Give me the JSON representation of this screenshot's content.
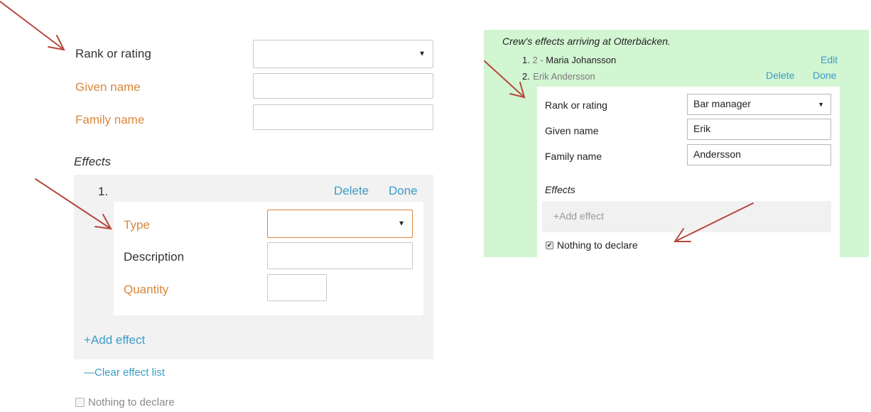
{
  "left": {
    "rank_label": "Rank or rating",
    "given_label": "Given name",
    "family_label": "Family name",
    "effects_title": "Effects",
    "effect": {
      "index": "1.",
      "delete_label": "Delete",
      "done_label": "Done",
      "type_label": "Type",
      "description_label": "Description",
      "quantity_label": "Quantity"
    },
    "add_effect_label": "+Add effect",
    "clear_label": "—Clear effect list",
    "nothing_label": "Nothing to declare"
  },
  "right": {
    "title": "Crew's effects arriving at Otterbäcken.",
    "crew": [
      {
        "index": "1.",
        "prefix": "2 -",
        "name": "Maria Johansson",
        "action": "Edit"
      },
      {
        "index": "2.",
        "name": "Erik Andersson",
        "delete_label": "Delete",
        "done_label": "Done"
      }
    ],
    "form": {
      "rank_label": "Rank or rating",
      "rank_value": "Bar manager",
      "given_label": "Given name",
      "given_value": "Erik",
      "family_label": "Family name",
      "family_value": "Andersson",
      "effects_title": "Effects",
      "add_effect_label": "+Add effect",
      "nothing_label": "Nothing to declare",
      "nothing_checked": true
    }
  },
  "colors": {
    "required_label": "#d9883c",
    "link": "#3a9dc6",
    "panel_green": "#d2f5d2",
    "annotation_arrow": "#b5483c"
  }
}
